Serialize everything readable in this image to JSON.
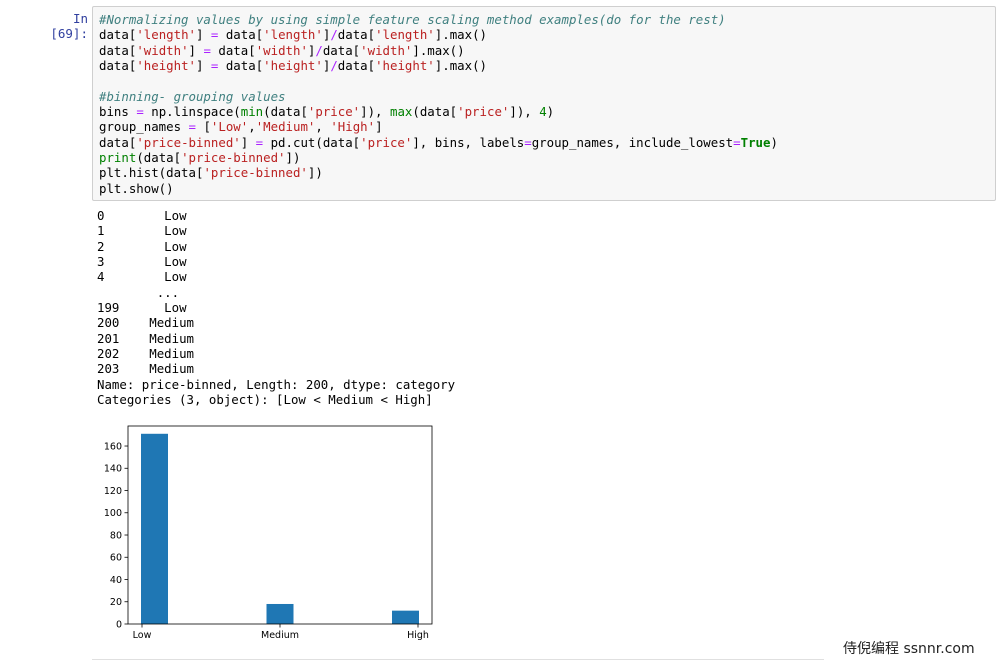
{
  "cell": {
    "prompt": "In [69]:"
  },
  "code": {
    "comment1": "#Normalizing values by using simple feature scaling method examples(do for the rest)",
    "comment2": "#binning- grouping values"
  },
  "output": {
    "rows": [
      {
        "index": "0",
        "value": "Low"
      },
      {
        "index": "1",
        "value": "Low"
      },
      {
        "index": "2",
        "value": "Low"
      },
      {
        "index": "3",
        "value": "Low"
      },
      {
        "index": "4",
        "value": "Low"
      },
      {
        "index": "",
        "value": "..."
      },
      {
        "index": "199",
        "value": "Low"
      },
      {
        "index": "200",
        "value": "Medium"
      },
      {
        "index": "201",
        "value": "Medium"
      },
      {
        "index": "202",
        "value": "Medium"
      },
      {
        "index": "203",
        "value": "Medium"
      }
    ],
    "name_line": "Name: price-binned, Length: 200, dtype: category",
    "categories_line": "Categories (3, object): [Low < Medium < High]"
  },
  "chart_data": {
    "type": "bar",
    "title": "",
    "xlabel": "",
    "ylabel": "",
    "categories": [
      "Low",
      "Medium",
      "High"
    ],
    "values": [
      171,
      18,
      12
    ],
    "ylim": [
      0,
      178
    ],
    "yticks": [
      0,
      20,
      40,
      60,
      80,
      100,
      120,
      140,
      160
    ],
    "bar_color": "#1f77b4",
    "grid": false
  },
  "watermark": "侍倪编程 ssnnr.com"
}
